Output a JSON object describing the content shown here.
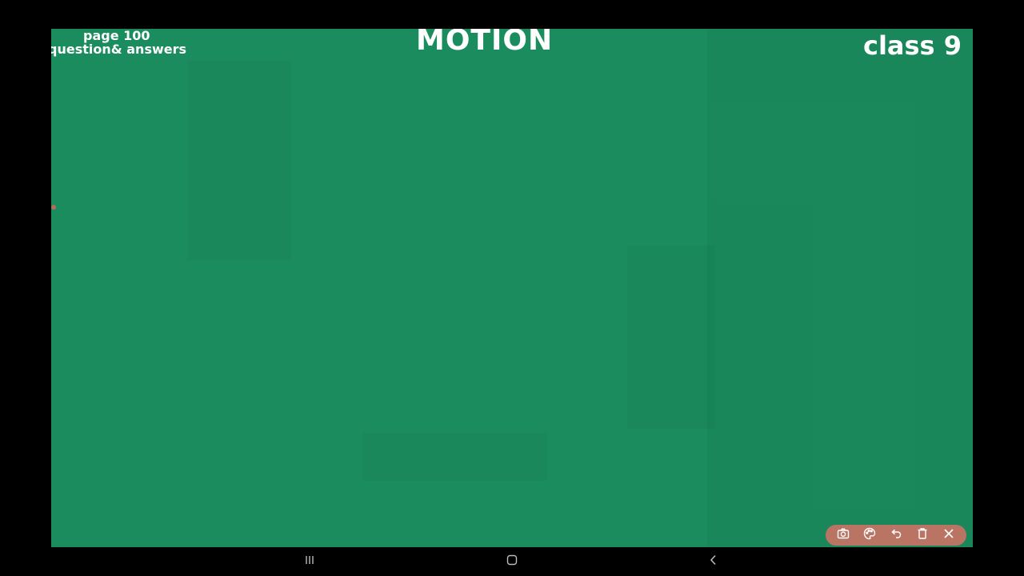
{
  "slide": {
    "page_label": "page 100",
    "subtitle": "question& answers",
    "title": "MOTION",
    "class_label": "class 9",
    "background_color": "#1b8c5e"
  },
  "toolbar": {
    "background_color": "#b97464",
    "buttons": [
      {
        "icon": "camera-icon"
      },
      {
        "icon": "palette-icon"
      },
      {
        "icon": "undo-icon"
      },
      {
        "icon": "delete-icon"
      },
      {
        "icon": "close-icon"
      }
    ]
  },
  "navbar": {
    "buttons": [
      {
        "icon": "recent-apps-icon"
      },
      {
        "icon": "home-icon"
      },
      {
        "icon": "back-icon"
      }
    ]
  }
}
